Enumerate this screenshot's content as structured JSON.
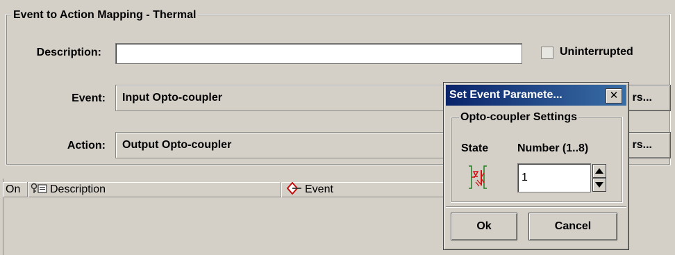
{
  "group": {
    "title": "Event to Action Mapping - Thermal"
  },
  "description": {
    "label": "Description:",
    "value": "",
    "placeholder": ""
  },
  "uninterrupted": {
    "label": "Uninterrupted",
    "checked": false
  },
  "event": {
    "label": "Event:",
    "value": "Input Opto-coupler",
    "button_label": "rs..."
  },
  "action": {
    "label": "Action:",
    "value": "Output Opto-coupler",
    "button_label": "rs..."
  },
  "table": {
    "columns": [
      {
        "label": "On",
        "icon": ""
      },
      {
        "label": "Description",
        "icon": "key-doc-icon"
      },
      {
        "label": "Event",
        "icon": "event-diamond-icon"
      }
    ]
  },
  "dialog": {
    "title": "Set Event Paramete...",
    "close_label": "✕",
    "group_title": "Opto-coupler Settings",
    "state_label": "State",
    "state_icon": "opto-coupler-icon",
    "number_label": "Number (1..8)",
    "number_value": "1",
    "ok_label": "Ok",
    "cancel_label": "Cancel"
  },
  "colors": {
    "titlebar": "#0a246a",
    "background": "#d4d0c8",
    "icon_red": "#d01010",
    "icon_green": "#208020"
  }
}
